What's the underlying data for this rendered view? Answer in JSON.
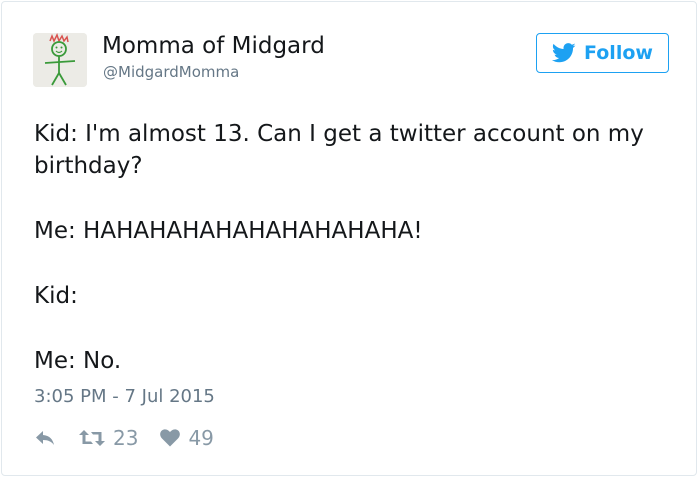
{
  "author": {
    "display_name": "Momma of Midgard",
    "handle": "@MidgardMomma"
  },
  "follow_button": {
    "label": "Follow"
  },
  "tweet": {
    "paragraphs": [
      "Kid: I'm almost 13. Can I get a twitter account on my birthday?",
      "Me: HAHAHAHAHAHAHAHAHAHA!",
      "Kid:",
      "Me: No."
    ],
    "timestamp": "3:05 PM - 7 Jul 2015"
  },
  "stats": {
    "retweets": "23",
    "likes": "49"
  },
  "colors": {
    "twitter_blue": "#1da1f2",
    "text": "#14171a",
    "secondary_text": "#657786",
    "action_gray": "#8899a6"
  },
  "icons": {
    "follow": "bird-icon",
    "reply": "reply-icon",
    "retweet": "retweet-icon",
    "like": "heart-icon"
  }
}
